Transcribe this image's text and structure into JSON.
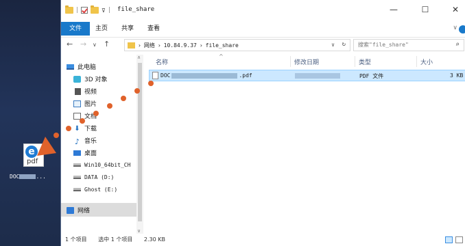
{
  "desktop": {
    "file_icon": {
      "icon": "edge-pdf-icon",
      "glyph": "e",
      "pdf_text": "pdf",
      "label": "DOC",
      "label_suffix": "..."
    }
  },
  "window": {
    "title": "file_share",
    "controls": {
      "minimize": "—",
      "maximize": "☐",
      "close": "✕"
    },
    "ribbon_tabs": [
      "文件",
      "主页",
      "共享",
      "查看"
    ],
    "ribbon_chevron": "∨",
    "nav": {
      "back": "←",
      "forward": "→",
      "up": "↑",
      "dropdown": "∨"
    },
    "address": {
      "crumb_sep": "›",
      "crumbs": [
        "网络",
        "10.84.9.37",
        "file_share"
      ],
      "drop": "∨",
      "refresh": "↻"
    },
    "search": {
      "placeholder": "搜索\"file_share\"",
      "icon": "⌕"
    }
  },
  "left_pane": {
    "items": [
      {
        "label": "此电脑",
        "icon": "computer-icon"
      },
      {
        "label": "3D 对象",
        "icon": "3d-objects-icon"
      },
      {
        "label": "视频",
        "icon": "video-icon"
      },
      {
        "label": "图片",
        "icon": "pictures-icon"
      },
      {
        "label": "文档",
        "icon": "documents-icon"
      },
      {
        "label": "下载",
        "icon": "download-icon"
      },
      {
        "label": "音乐",
        "icon": "music-icon"
      },
      {
        "label": "桌面",
        "icon": "desktop-icon"
      },
      {
        "label": "Win10_64bit_CH",
        "icon": "drive-icon"
      },
      {
        "label": "DATA (D:)",
        "icon": "drive-icon"
      },
      {
        "label": "Ghost (E:)",
        "icon": "drive-icon"
      },
      {
        "label": "网络",
        "icon": "network-icon"
      }
    ],
    "scroll_up": "∧",
    "scroll_down": "∨"
  },
  "columns": {
    "name": "名称",
    "date": "修改日期",
    "type": "类型",
    "size": "大小",
    "sort_caret": "^"
  },
  "files": [
    {
      "name_prefix": "DOC",
      "name_suffix": ".pdf",
      "type": "PDF 文件",
      "size": "3 KB",
      "icon": "pdf-file-icon"
    }
  ],
  "status": {
    "item_count": "1 个项目",
    "selected": "选中 1 个项目",
    "size": "2.30 KB"
  },
  "colors": {
    "accent": "#1979ca",
    "selection_bg": "#cce8ff",
    "drag_path": "#e0622b"
  }
}
